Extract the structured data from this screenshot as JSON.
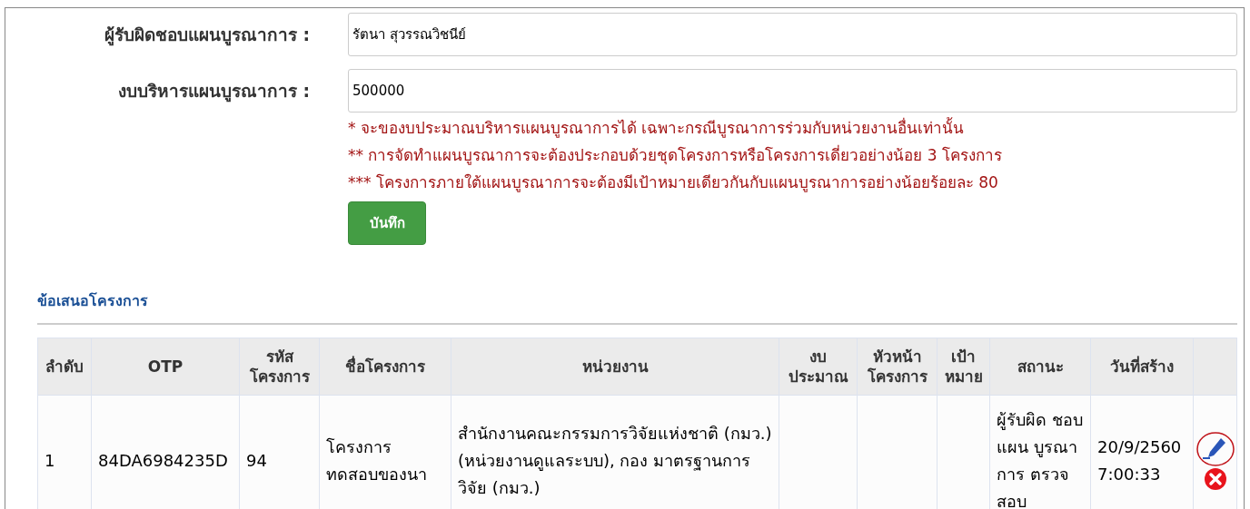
{
  "form": {
    "fields": [
      {
        "label": "ผู้รับผิดชอบแผนบูรณาการ :",
        "value": "รัตนา สุวรรณวิชนีย์"
      },
      {
        "label": "งบบริหารแผนบูรณาการ :",
        "value": "500000"
      }
    ],
    "notes": [
      "* จะของบประมาณบริหารแผนบูรณาการได้ เฉพาะกรณีบูรณาการร่วมกับหน่วยงานอื่นเท่านั้น",
      "** การจัดทำแผนบูรณาการจะต้องประกอบด้วยชุดโครงการหรือโครงการเดี่ยวอย่างน้อย 3 โครงการ",
      "*** โครงการภายใต้แผนบูรณาการจะต้องมีเป้าหมายเดียวกันกับแผนบูรณาการอย่างน้อยร้อยละ 80"
    ],
    "save_button": "บันทึก"
  },
  "section_title": "ข้อเสนอโครงการ",
  "table": {
    "columns": [
      "ลำดับ",
      "OTP",
      "รหัส โครงการ",
      "ชื่อโครงการ",
      "หน่วยงาน",
      "งบ ประมาณ",
      "หัวหน้า โครงการ",
      "เป้า หมาย",
      "สถานะ",
      "วันที่สร้าง"
    ],
    "rows": [
      {
        "cells": [
          "1",
          "84DA6984235D",
          "94",
          "โครงการ ทดสอบของนา",
          "สำนักงานคณะกรรมการวิจัยแห่งชาติ (กมว.)(หน่วยงานดูแลระบบ), กอง มาตรฐานการวิจัย (กมว.)",
          "",
          "",
          "",
          "ผู้รับผิด ชอบแผน บูรณาการ ตรวจสอบ",
          "20/9/2560 7:00:33"
        ],
        "edit_highlighted": true
      }
    ]
  }
}
